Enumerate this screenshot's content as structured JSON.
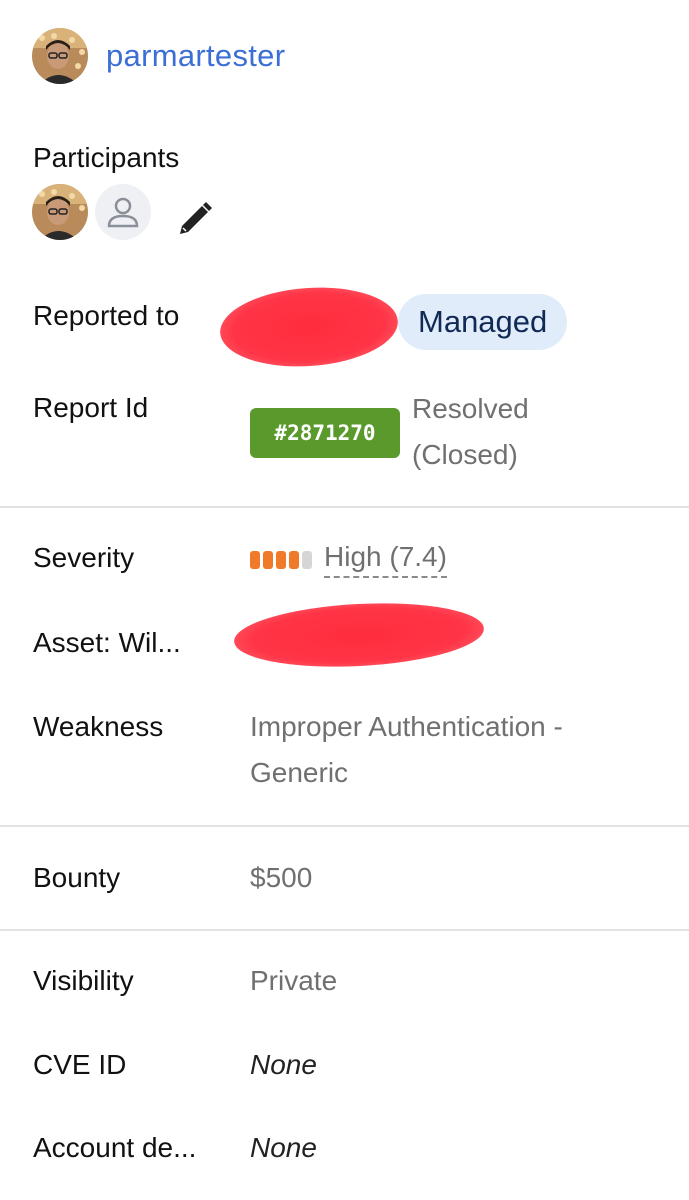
{
  "reporter": {
    "username": "parmartester"
  },
  "participants": {
    "label": "Participants"
  },
  "reported_to": {
    "label": "Reported to",
    "badge": "Managed"
  },
  "report_id": {
    "label": "Report Id",
    "id": "#2871270",
    "status_line1": "Resolved",
    "status_line2": "(Closed)"
  },
  "severity": {
    "label": "Severity",
    "value": "High (7.4)",
    "filled_segments": 4,
    "total_segments": 5
  },
  "asset": {
    "label": "Asset: Wil..."
  },
  "weakness": {
    "label": "Weakness",
    "line1": "Improper Authentication -",
    "line2": "Generic"
  },
  "bounty": {
    "label": "Bounty",
    "value": "$500"
  },
  "visibility": {
    "label": "Visibility",
    "value": "Private"
  },
  "cve": {
    "label": "CVE ID",
    "value": "None"
  },
  "account": {
    "label": "Account de...",
    "value": "None"
  },
  "colors": {
    "link": "#3b6fd6",
    "report_badge": "#5a9a2c",
    "managed_bg": "#e1ecfa",
    "severity_high": "#f07a2a",
    "redaction": "#ff2d3d"
  }
}
